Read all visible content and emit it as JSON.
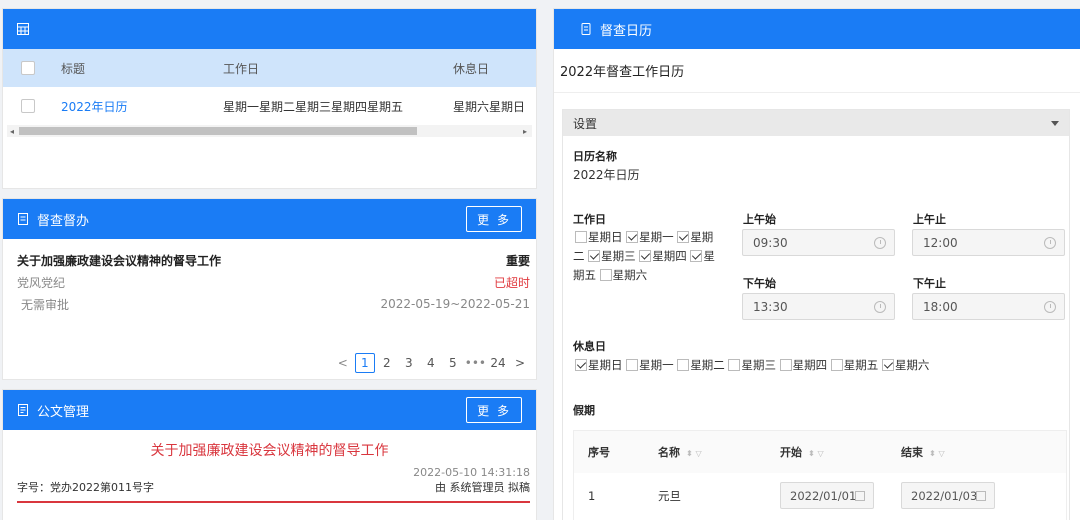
{
  "calendar_list": {
    "headers": {
      "title": "标题",
      "workdays": "工作日",
      "restdays": "休息日"
    },
    "rows": [
      {
        "title": "2022年日历",
        "workdays": "星期一星期二星期三星期四星期五",
        "restdays": "星期六星期日"
      }
    ]
  },
  "supervision": {
    "title": "督查督办",
    "more": "更 多",
    "item": {
      "title": "关于加强廉政建设会议精神的督导工作",
      "priority": "重要",
      "dept": "党风党纪",
      "status": "已超时",
      "approval": "无需审批",
      "period": "2022-05-19~2022-05-21"
    },
    "pager": {
      "prev": "<",
      "pages": [
        "1",
        "2",
        "3",
        "4",
        "5"
      ],
      "ellipsis": "•••",
      "last": "24",
      "next": ">"
    }
  },
  "documents": {
    "title": "公文管理",
    "more": "更 多",
    "doc_title": "关于加强廉政建设会议精神的督导工作",
    "time": "2022-05-10 14:31:18",
    "number": "字号：党办2022第011号字",
    "author": "由 系统管理员 拟稿"
  },
  "calendar_detail": {
    "header": "督查日历",
    "name_heading": "2022年督查工作日历",
    "settings_label": "设置",
    "name_label": "日历名称",
    "name_value": "2022年日历",
    "workday_label": "工作日",
    "workday_lines": [
      [
        {
          "label": "星期日",
          "checked": false
        },
        {
          "label": "星期一",
          "checked": true
        },
        {
          "label": "星期",
          "checked": true
        }
      ],
      [
        {
          "label": "二",
          "checked": null
        },
        {
          "label": "星期三",
          "checked": true
        },
        {
          "label": "星期四",
          "checked": true
        },
        {
          "label": "星",
          "checked": true
        }
      ],
      [
        {
          "label": "期五",
          "checked": null
        },
        {
          "label": "星期六",
          "checked": false
        }
      ]
    ],
    "am_start_label": "上午始",
    "am_start": "09:30",
    "am_end_label": "上午止",
    "am_end": "12:00",
    "pm_start_label": "下午始",
    "pm_start": "13:30",
    "pm_end_label": "下午止",
    "pm_end": "18:00",
    "restday_label": "休息日",
    "restdays": [
      {
        "label": "星期日",
        "checked": true
      },
      {
        "label": "星期一",
        "checked": false
      },
      {
        "label": "星期二",
        "checked": false
      },
      {
        "label": "星期三",
        "checked": false
      },
      {
        "label": "星期四",
        "checked": false
      },
      {
        "label": "星期五",
        "checked": false
      },
      {
        "label": "星期六",
        "checked": true
      }
    ],
    "holiday_label": "假期",
    "holiday_headers": {
      "no": "序号",
      "name": "名称",
      "start": "开始",
      "end": "结束"
    },
    "holidays": [
      {
        "no": "1",
        "name": "元旦",
        "start": "2022/01/01",
        "end": "2022/01/03"
      }
    ]
  }
}
